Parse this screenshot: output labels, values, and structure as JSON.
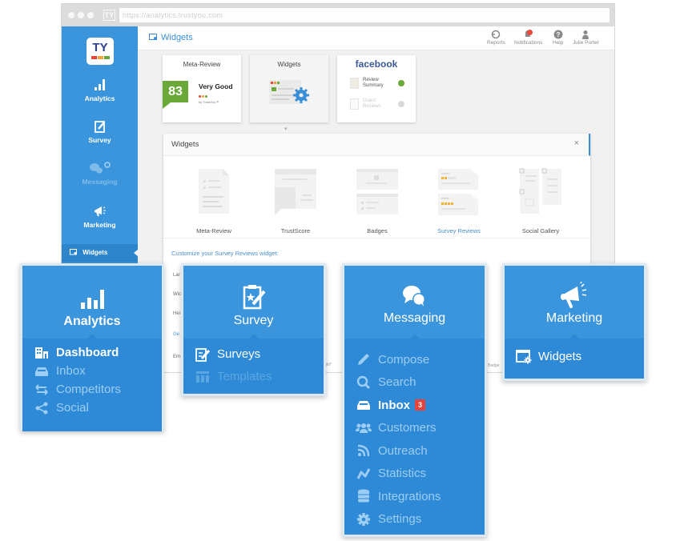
{
  "browser": {
    "url": "https://analytics.trustyou.com",
    "favicon": "TY"
  },
  "sidebar": {
    "logo_text": "TY",
    "logo_colors": [
      "#e8433a",
      "#f2a03a",
      "#6aa83a"
    ],
    "items": [
      {
        "label": "Analytics",
        "icon": "bar-chart-icon",
        "state": "normal"
      },
      {
        "label": "Survey",
        "icon": "survey-clipboard-icon",
        "state": "normal"
      },
      {
        "label": "Messaging",
        "icon": "chat-bubbles-icon",
        "state": "dimmed"
      },
      {
        "label": "Marketing",
        "icon": "megaphone-icon",
        "state": "normal"
      }
    ],
    "active_subitem": {
      "label": "Widgets",
      "icon": "widget-icon"
    }
  },
  "topbar": {
    "title": "Widgets",
    "title_icon": "widget-icon",
    "actions": [
      {
        "label": "Reports",
        "icon": "reports-icon"
      },
      {
        "label": "Notifications",
        "icon": "bell-icon",
        "has_dot": true
      },
      {
        "label": "Help",
        "icon": "help-icon"
      },
      {
        "label": "Julie Porter",
        "icon": "user-icon"
      }
    ]
  },
  "tiles": [
    {
      "title": "Meta-Review",
      "score": "83",
      "rating": "Very Good",
      "byline": "by TrustYou™",
      "score_color": "#6aa83a"
    },
    {
      "title": "Widgets",
      "selected": true
    },
    {
      "title": "facebook",
      "rows": [
        {
          "label": "Review Summary",
          "enabled": true
        },
        {
          "label": "Guest Reviews",
          "enabled": false
        }
      ]
    }
  ],
  "panel": {
    "title": "Widgets",
    "close_label": "×",
    "widgets": [
      {
        "name": "Meta-Review",
        "active": false
      },
      {
        "name": "TrustScore",
        "active": false
      },
      {
        "name": "Badges",
        "active": false
      },
      {
        "name": "Survey Reviews",
        "active": true
      },
      {
        "name": "Social Gallery",
        "active": false
      }
    ],
    "customize_label": "Customize your Survey Reviews widget:",
    "form_labels_truncated": [
      "Lar",
      "Wic",
      "Hei",
      "Ge",
      "Em"
    ],
    "stub_texts": [
      "ght*",
      "Badge"
    ]
  },
  "menus": [
    {
      "title": "Analytics",
      "icon": "bar-chart-icon",
      "items": [
        {
          "label": "Dashboard",
          "icon": "dashboard-icon",
          "style": "bold"
        },
        {
          "label": "Inbox",
          "icon": "inbox-icon",
          "style": "normal"
        },
        {
          "label": "Competitors",
          "icon": "arrows-exchange-icon",
          "style": "normal"
        },
        {
          "label": "Social",
          "icon": "share-icon",
          "style": "normal"
        }
      ]
    },
    {
      "title": "Survey",
      "icon": "survey-clipboard-icon",
      "items": [
        {
          "label": "Surveys",
          "icon": "edit-list-icon",
          "style": "active"
        },
        {
          "label": "Templates",
          "icon": "templates-icon",
          "style": "faded"
        }
      ]
    },
    {
      "title": "Messaging",
      "icon": "chat-bubbles-icon",
      "items": [
        {
          "label": "Compose",
          "icon": "pencil-icon",
          "style": "normal"
        },
        {
          "label": "Search",
          "icon": "search-icon",
          "style": "normal"
        },
        {
          "label": "Inbox",
          "icon": "inbox-icon",
          "style": "bold",
          "badge": "3"
        },
        {
          "label": "Customers",
          "icon": "users-icon",
          "style": "normal"
        },
        {
          "label": "Outreach",
          "icon": "rss-icon",
          "style": "normal"
        },
        {
          "label": "Statistics",
          "icon": "line-chart-icon",
          "style": "normal"
        },
        {
          "label": "Integrations",
          "icon": "database-icon",
          "style": "normal"
        },
        {
          "label": "Settings",
          "icon": "gear-icon",
          "style": "normal"
        }
      ]
    },
    {
      "title": "Marketing",
      "icon": "megaphone-icon",
      "items": [
        {
          "label": "Widgets",
          "icon": "widget-icon",
          "style": "active"
        }
      ]
    }
  ],
  "colors": {
    "brand_blue": "#3b95dd",
    "brand_blue_dark": "#2e8ad6",
    "link_blue": "#4a8fd1",
    "badge_red": "#e8433a",
    "score_green": "#6aa83a",
    "facebook_blue": "#3b5998"
  }
}
